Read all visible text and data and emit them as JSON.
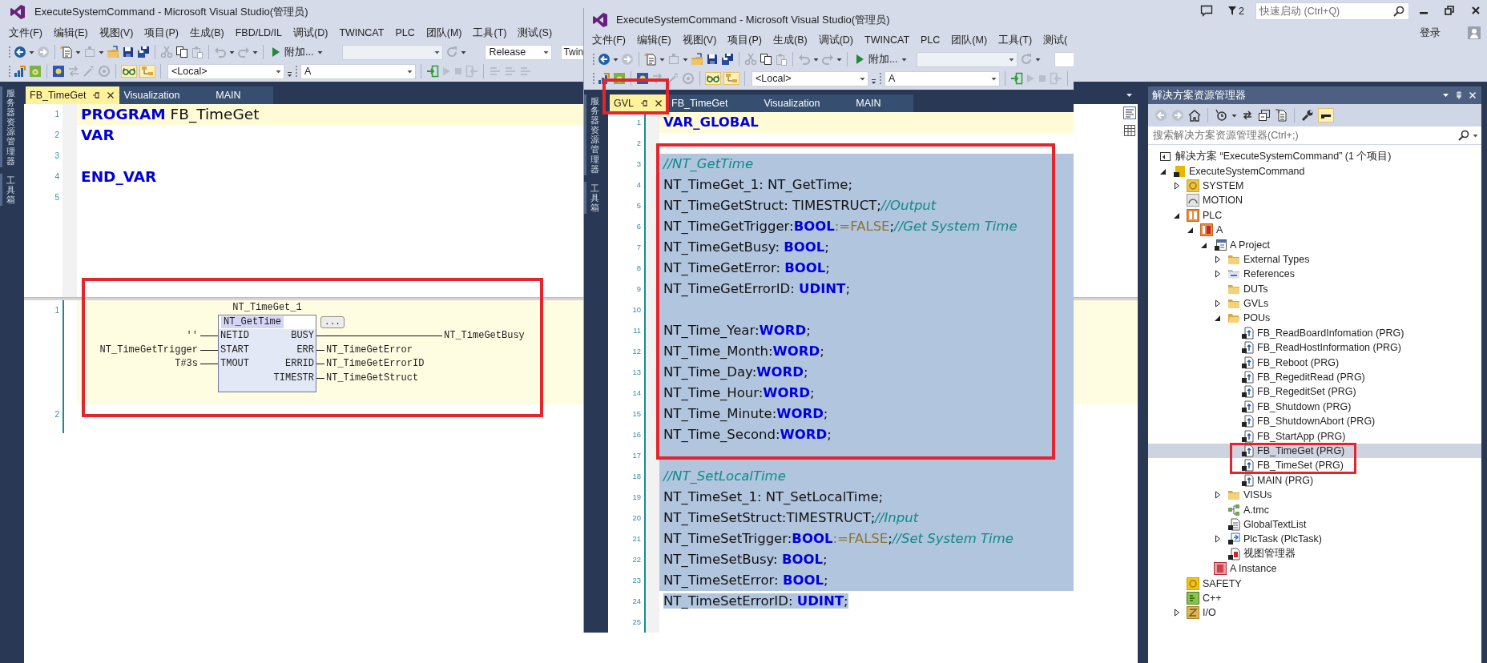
{
  "main_window": {
    "title": "ExecuteSystemCommand - Microsoft Visual Studio(管理员)",
    "menu": [
      "文件(F)",
      "编辑(E)",
      "视图(V)",
      "项目(P)",
      "生成(B)",
      "FBD/LD/IL",
      "调试(D)",
      "TWINCAT",
      "PLC",
      "团队(M)",
      "工具(T)",
      "测试(S)"
    ],
    "toolbar": {
      "attach_button": "附加...",
      "combos": [
        {
          "disabled": true
        },
        {
          "value": "Release",
          "disabled": false
        },
        {
          "value": "Twin",
          "disabled": false
        }
      ]
    },
    "toolbar_2": {
      "combos": [
        {
          "value": "<Local>",
          "disabled": false
        },
        {
          "value": "A",
          "disabled": false
        }
      ]
    },
    "notification_count": "2",
    "quick_launch": {
      "placeholder": "快速启动 (Ctrl+Q)"
    },
    "sign_in": "登录",
    "side_tabs": [
      "服务器资源管理器",
      "工具箱"
    ],
    "doc_tabs": [
      {
        "label": "FB_TimeGet",
        "selected": true
      },
      {
        "label": "Visualization",
        "selected": false
      },
      {
        "label": "MAIN",
        "selected": false
      }
    ],
    "editor": {
      "lines": [
        {
          "number": "1",
          "current": true,
          "tokens": [
            {
              "kind": "keyword",
              "text": "PROGRAM"
            },
            {
              "kind": "plain",
              "text": " FB_TimeGet"
            }
          ]
        },
        {
          "number": "2",
          "current": false,
          "tokens": [
            {
              "kind": "keyword",
              "text": "VAR"
            }
          ]
        },
        {
          "number": "3",
          "current": false
        },
        {
          "number": "4",
          "current": false,
          "tokens": [
            {
              "kind": "keyword",
              "text": "END_VAR"
            }
          ]
        },
        {
          "number": "5",
          "current": false
        }
      ]
    },
    "fbd": {
      "networks": [
        {
          "number": "1",
          "selected": true,
          "boxed": true,
          "block": {
            "instance": "NT_TimeGet_1",
            "type": "NT_GetTime",
            "more_button": "...",
            "inputs": [
              {
                "variable": "''",
                "pin": "NETID"
              },
              {
                "variable": "NT_TimeGetTrigger",
                "pin": "START"
              },
              {
                "variable": "T#3s",
                "pin": "TMOUT"
              }
            ],
            "outputs": [
              {
                "pin": "BUSY",
                "variable": "NT_TimeGetBusy"
              },
              {
                "pin": "ERR",
                "variable": "NT_TimeGetError"
              },
              {
                "pin": "ERRID",
                "variable": "NT_TimeGetErrorID"
              },
              {
                "pin": "TIMESTR",
                "variable": "NT_TimeGetStruct"
              }
            ]
          }
        },
        {
          "number": "2",
          "selected": false
        }
      ]
    }
  },
  "solution_explorer": {
    "title": "解决方案资源管理器",
    "search": {
      "placeholder": "搜索解决方案资源管理器(Ctrl+;)"
    },
    "tree": [
      {
        "label": "解决方案 “ExecuteSystemCommand” (1 个项目)",
        "kind": "solution",
        "selected": false,
        "boxed": false,
        "children": [
          {
            "label": "ExecuteSystemCommand",
            "kind": "project",
            "selected": false,
            "boxed": false,
            "expanded": true,
            "children": [
              {
                "label": "SYSTEM",
                "kind": "system",
                "selected": false,
                "boxed": false,
                "expanded": false
              },
              {
                "label": "MOTION",
                "kind": "motion",
                "selected": false,
                "boxed": false
              },
              {
                "label": "PLC",
                "kind": "plc",
                "selected": false,
                "boxed": false,
                "expanded": true,
                "children": [
                  {
                    "label": "A",
                    "kind": "plc-project",
                    "selected": false,
                    "boxed": false,
                    "expanded": true,
                    "children": [
                      {
                        "label": "A Project",
                        "kind": "project-node",
                        "selected": false,
                        "boxed": false,
                        "expanded": true,
                        "children": [
                          {
                            "label": "External Types",
                            "kind": "folder",
                            "selected": false,
                            "boxed": false,
                            "expanded": false
                          },
                          {
                            "label": "References",
                            "kind": "references",
                            "selected": false,
                            "boxed": false,
                            "expanded": false
                          },
                          {
                            "label": "DUTs",
                            "kind": "folder",
                            "selected": false,
                            "boxed": false
                          },
                          {
                            "label": "GVLs",
                            "kind": "folder",
                            "selected": false,
                            "boxed": false,
                            "expanded": false
                          },
                          {
                            "label": "POUs",
                            "kind": "open-folder",
                            "selected": false,
                            "boxed": false,
                            "expanded": true,
                            "children": [
                              {
                                "label": "FB_ReadBoardInfomation (PRG)",
                                "kind": "pou",
                                "selected": false,
                                "boxed": false
                              },
                              {
                                "label": "FB_ReadHostInformation (PRG)",
                                "kind": "pou",
                                "selected": false,
                                "boxed": false
                              },
                              {
                                "label": "FB_Reboot (PRG)",
                                "kind": "pou",
                                "selected": false,
                                "boxed": false
                              },
                              {
                                "label": "FB_RegeditRead (PRG)",
                                "kind": "pou",
                                "selected": false,
                                "boxed": false
                              },
                              {
                                "label": "FB_RegeditSet (PRG)",
                                "kind": "pou",
                                "selected": false,
                                "boxed": false
                              },
                              {
                                "label": "FB_Shutdown (PRG)",
                                "kind": "pou",
                                "selected": false,
                                "boxed": false
                              },
                              {
                                "label": "FB_ShutdownAbort (PRG)",
                                "kind": "pou",
                                "selected": false,
                                "boxed": false
                              },
                              {
                                "label": "FB_StartApp (PRG)",
                                "kind": "pou",
                                "selected": false,
                                "boxed": false
                              },
                              {
                                "label": "FB_TimeGet (PRG)",
                                "kind": "pou",
                                "selected": true,
                                "boxed": true
                              },
                              {
                                "label": "FB_TimeSet (PRG)",
                                "kind": "pou",
                                "selected": false,
                                "boxed": true
                              },
                              {
                                "label": "MAIN (PRG)",
                                "kind": "pou",
                                "selected": false,
                                "boxed": false
                              }
                            ]
                          },
                          {
                            "label": "VISUs",
                            "kind": "folder",
                            "selected": false,
                            "boxed": false,
                            "expanded": false
                          },
                          {
                            "label": "A.tmc",
                            "kind": "tmc",
                            "selected": false,
                            "boxed": false
                          },
                          {
                            "label": "GlobalTextList",
                            "kind": "text-list",
                            "selected": false,
                            "boxed": false
                          },
                          {
                            "label": "PlcTask (PlcTask)",
                            "kind": "task",
                            "selected": false,
                            "boxed": false,
                            "expanded": false
                          },
                          {
                            "label": "视图管理器",
                            "kind": "view-manager",
                            "selected": false,
                            "boxed": false
                          }
                        ]
                      },
                      {
                        "label": "A Instance",
                        "kind": "instance",
                        "selected": false,
                        "boxed": false
                      }
                    ]
                  }
                ]
              },
              {
                "label": "SAFETY",
                "kind": "safety",
                "selected": false,
                "boxed": false
              },
              {
                "label": "C++",
                "kind": "cpp",
                "selected": false,
                "boxed": false
              },
              {
                "label": "I/O",
                "kind": "io",
                "selected": false,
                "boxed": false,
                "expanded": false
              }
            ]
          }
        ]
      }
    ]
  },
  "front_window": {
    "title": "ExecuteSystemCommand - Microsoft Visual Studio(管理员)",
    "menu": [
      "文件(F)",
      "编辑(E)",
      "视图(V)",
      "项目(P)",
      "生成(B)",
      "调试(D)",
      "TWINCAT",
      "PLC",
      "团队(M)",
      "工具(T)",
      "测试("
    ],
    "toolbar": {
      "attach_button": "附加...",
      "combos": [
        {
          "disabled": true
        },
        {
          "disabled": false
        }
      ]
    },
    "toolbar_2": {
      "combos": [
        {
          "value": "<Local>",
          "disabled": false
        },
        {
          "value": "A",
          "disabled": false
        }
      ]
    },
    "side_tabs": [
      "服务器资源管理器",
      "工具箱"
    ],
    "doc_tabs": [
      {
        "label": "GVL",
        "selected": true,
        "boxed": true
      },
      {
        "label": "FB_TimeGet",
        "selected": false,
        "boxed": false
      },
      {
        "label": "Visualization",
        "selected": false,
        "boxed": false
      },
      {
        "label": "MAIN",
        "selected": false,
        "boxed": false
      }
    ],
    "editor": {
      "lines": [
        {
          "number": "1",
          "current": true,
          "selected": false,
          "tokens": [
            {
              "kind": "keyword",
              "text": "VAR_GLOBAL"
            }
          ]
        },
        {
          "number": "2",
          "current": false,
          "selected": false
        },
        {
          "number": "3",
          "current": false,
          "selected": true,
          "boxed": true,
          "tokens": [
            {
              "kind": "comment",
              "text": "//NT_GetTime"
            }
          ]
        },
        {
          "number": "4",
          "current": false,
          "selected": true,
          "boxed": true,
          "tokens": [
            {
              "kind": "plain",
              "text": "NT_TimeGet_1: NT_GetTime;"
            }
          ]
        },
        {
          "number": "5",
          "current": false,
          "selected": true,
          "boxed": true,
          "tokens": [
            {
              "kind": "plain",
              "text": "NT_TimeGetStruct: TIMESTRUCT;"
            },
            {
              "kind": "comment",
              "text": "//Output"
            }
          ]
        },
        {
          "number": "6",
          "current": false,
          "selected": true,
          "boxed": true,
          "tokens": [
            {
              "kind": "plain",
              "text": "NT_TimeGetTrigger:"
            },
            {
              "kind": "keyword",
              "text": "BOOL"
            },
            {
              "kind": "literal",
              "text": ":=FALSE"
            },
            {
              "kind": "plain",
              "text": ";"
            },
            {
              "kind": "comment",
              "text": "//Get System Time"
            }
          ]
        },
        {
          "number": "7",
          "current": false,
          "selected": true,
          "boxed": true,
          "tokens": [
            {
              "kind": "plain",
              "text": "NT_TimeGetBusy: "
            },
            {
              "kind": "keyword",
              "text": "BOOL"
            },
            {
              "kind": "plain",
              "text": ";"
            }
          ]
        },
        {
          "number": "8",
          "current": false,
          "selected": true,
          "boxed": true,
          "tokens": [
            {
              "kind": "plain",
              "text": "NT_TimeGetError: "
            },
            {
              "kind": "keyword",
              "text": "BOOL"
            },
            {
              "kind": "plain",
              "text": ";"
            }
          ]
        },
        {
          "number": "9",
          "current": false,
          "selected": true,
          "boxed": true,
          "tokens": [
            {
              "kind": "plain",
              "text": "NT_TimeGetErrorID: "
            },
            {
              "kind": "keyword",
              "text": "UDINT"
            },
            {
              "kind": "plain",
              "text": ";"
            }
          ]
        },
        {
          "number": "10",
          "current": false,
          "selected": true,
          "boxed": true
        },
        {
          "number": "11",
          "current": false,
          "selected": true,
          "boxed": true,
          "tokens": [
            {
              "kind": "plain",
              "text": "NT_Time_Year:"
            },
            {
              "kind": "keyword",
              "text": "WORD"
            },
            {
              "kind": "plain",
              "text": ";"
            }
          ]
        },
        {
          "number": "12",
          "current": false,
          "selected": true,
          "boxed": true,
          "tokens": [
            {
              "kind": "plain",
              "text": "NT_Time_Month:"
            },
            {
              "kind": "keyword",
              "text": "WORD"
            },
            {
              "kind": "plain",
              "text": ";"
            }
          ]
        },
        {
          "number": "13",
          "current": false,
          "selected": true,
          "boxed": true,
          "tokens": [
            {
              "kind": "plain",
              "text": "NT_Time_Day:"
            },
            {
              "kind": "keyword",
              "text": "WORD"
            },
            {
              "kind": "plain",
              "text": ";"
            }
          ]
        },
        {
          "number": "14",
          "current": false,
          "selected": true,
          "boxed": true,
          "tokens": [
            {
              "kind": "plain",
              "text": "NT_Time_Hour:"
            },
            {
              "kind": "keyword",
              "text": "WORD"
            },
            {
              "kind": "plain",
              "text": ";"
            }
          ]
        },
        {
          "number": "15",
          "current": false,
          "selected": true,
          "boxed": true,
          "tokens": [
            {
              "kind": "plain",
              "text": "NT_Time_Minute:"
            },
            {
              "kind": "keyword",
              "text": "WORD"
            },
            {
              "kind": "plain",
              "text": ";"
            }
          ]
        },
        {
          "number": "16",
          "current": false,
          "selected": true,
          "boxed": true,
          "tokens": [
            {
              "kind": "plain",
              "text": "NT_Time_Second:"
            },
            {
              "kind": "keyword",
              "text": "WORD"
            },
            {
              "kind": "plain",
              "text": ";"
            }
          ]
        },
        {
          "number": "17",
          "current": false,
          "selected": true,
          "boxed": true
        },
        {
          "number": "18",
          "current": false,
          "selected": true,
          "tokens": [
            {
              "kind": "comment",
              "text": "//NT_SetLocalTime"
            }
          ]
        },
        {
          "number": "19",
          "current": false,
          "selected": true,
          "tokens": [
            {
              "kind": "plain",
              "text": "NT_TimeSet_1: NT_SetLocalTime;"
            }
          ]
        },
        {
          "number": "20",
          "current": false,
          "selected": true,
          "tokens": [
            {
              "kind": "plain",
              "text": "NT_TimeSetStruct:TIMESTRUCT;"
            },
            {
              "kind": "comment",
              "text": "//Input"
            }
          ]
        },
        {
          "number": "21",
          "current": false,
          "selected": true,
          "tokens": [
            {
              "kind": "plain",
              "text": "NT_TimeSetTrigger:"
            },
            {
              "kind": "keyword",
              "text": "BOOL"
            },
            {
              "kind": "literal",
              "text": ":=FALSE"
            },
            {
              "kind": "plain",
              "text": ";"
            },
            {
              "kind": "comment",
              "text": "//Set System Time"
            }
          ]
        },
        {
          "number": "22",
          "current": false,
          "selected": true,
          "tokens": [
            {
              "kind": "plain",
              "text": "NT_TimeSetBusy: "
            },
            {
              "kind": "keyword",
              "text": "BOOL"
            },
            {
              "kind": "plain",
              "text": ";"
            }
          ]
        },
        {
          "number": "23",
          "current": false,
          "selected": true,
          "tokens": [
            {
              "kind": "plain",
              "text": "NT_TimeSetError: "
            },
            {
              "kind": "keyword",
              "text": "BOOL"
            },
            {
              "kind": "plain",
              "text": ";"
            }
          ]
        },
        {
          "number": "24",
          "current": false,
          "selected": true,
          "tokens": [
            {
              "kind": "plain",
              "text": "NT_TimeSetErrorID: "
            },
            {
              "kind": "keyword",
              "text": "UDINT"
            },
            {
              "kind": "plain",
              "text": ";"
            }
          ]
        },
        {
          "number": "25",
          "current": false,
          "selected": false
        }
      ]
    }
  }
}
